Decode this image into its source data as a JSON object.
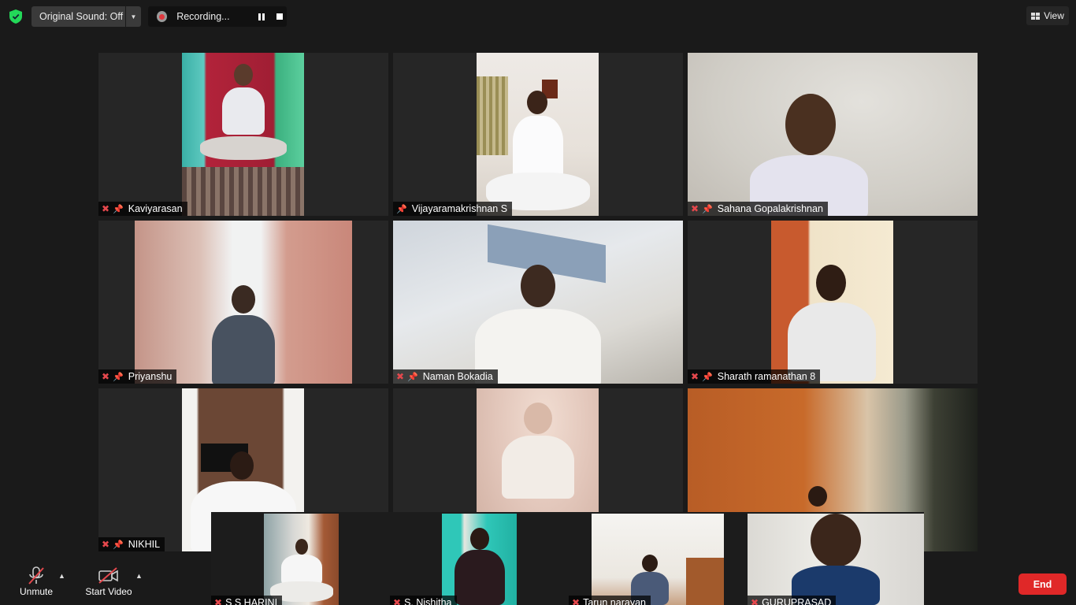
{
  "top_bar": {
    "original_sound_label": "Original Sound: Off",
    "recording_label": "Recording...",
    "view_label": "View"
  },
  "participants": [
    {
      "name": "Kaviyarasan",
      "muted": true,
      "pinned": true
    },
    {
      "name": "Vijayaramakrishnan S",
      "muted": false,
      "pinned": true
    },
    {
      "name": "Sahana Gopalakrishnan",
      "muted": true,
      "pinned": true
    },
    {
      "name": "Priyanshu",
      "muted": true,
      "pinned": true
    },
    {
      "name": "Naman Bokadia",
      "muted": true,
      "pinned": true
    },
    {
      "name": "Sharath ramanathan 8",
      "muted": true,
      "pinned": true
    },
    {
      "name": "NIKHIL",
      "muted": true,
      "pinned": true
    },
    {
      "name": "",
      "muted": false,
      "pinned": false
    },
    {
      "name": "",
      "muted": false,
      "pinned": false
    }
  ],
  "strip_participants": [
    {
      "name": "S S HARINI"
    },
    {
      "name": "S. Nishitha"
    },
    {
      "name": "Tarun narayan"
    },
    {
      "name": "GURUPRASAD"
    }
  ],
  "toolbar": {
    "unmute_label": "Unmute",
    "start_video_label": "Start Video",
    "end_label": "End"
  },
  "colors": {
    "background": "#1a1a1a",
    "tile_background": "#262626",
    "end_button": "#e02828",
    "muted_icon": "#e5484d",
    "security_shield": "#23d959"
  }
}
